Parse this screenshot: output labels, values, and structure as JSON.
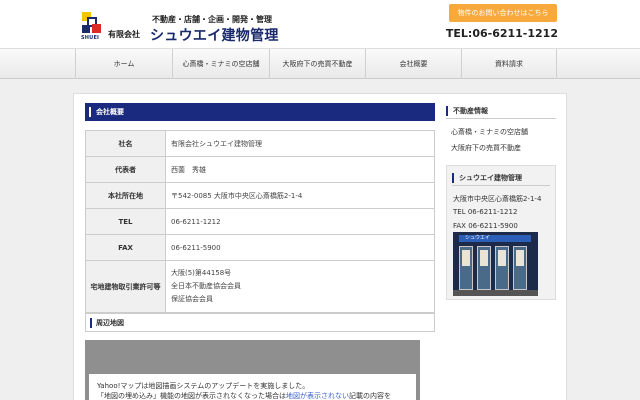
{
  "header": {
    "logo_subtext": "SHUEI",
    "corp_type": "有限会社",
    "tagline": "不動産・店舗・企画・開発・管理",
    "company_name": "シュウエイ建物管理",
    "contact_button": "物件のお問い合わせはこちら",
    "tel": "TEL:06-6211-1212"
  },
  "nav": {
    "items": [
      "ホーム",
      "心斎橋・ミナミの空店舗",
      "大阪府下の売買不動産",
      "会社概要",
      "資料請求"
    ]
  },
  "main": {
    "section_title": "会社概要",
    "table": [
      {
        "label": "社名",
        "value": "有限会社シュウエイ建物管理"
      },
      {
        "label": "代表者",
        "value": "西薗　秀雄"
      },
      {
        "label": "本社所在地",
        "value": "〒542-0085 大阪市中央区心斎橋筋2-1-4"
      },
      {
        "label": "TEL",
        "value": "06-6211-1212"
      },
      {
        "label": "FAX",
        "value": "06-6211-5900"
      },
      {
        "label": "宅地建物取引業許可等",
        "values": [
          "大阪(5)第44158号",
          "全日本不動産協会会員",
          "保証協会会員"
        ]
      }
    ],
    "map_section_title": "周辺地図",
    "map_notice_line1": "Yahoo!マップは地図描画システムのアップデートを実施しました。",
    "map_notice_line2_a": "「地図の埋め込み」機能の地図が表示されなくなった場合は",
    "map_notice_link": "地図が表示されない",
    "map_notice_line2_b": "記載の内容を"
  },
  "sidebar": {
    "title": "不動産情報",
    "links": [
      "心斎橋・ミナミの空店舗",
      "大阪府下の売買不動産"
    ],
    "company_box": {
      "title": "シュウエイ建物管理",
      "address": "大阪市中央区心斎橋筋2-1-4",
      "tel": "TEL 06-6211-1212",
      "fax": "FAX 06-6211-5900",
      "photo_sign": "シュウエイ"
    }
  },
  "colors": {
    "brand_blue": "#1a2a7e",
    "accent_orange": "#f7a93c"
  }
}
